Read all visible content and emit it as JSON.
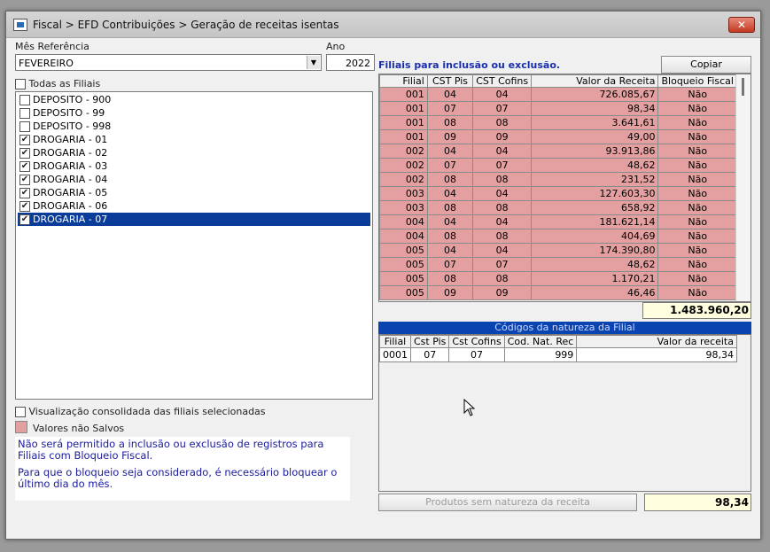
{
  "window": {
    "title": "Fiscal > EFD Contribuições > Geração de receitas isentas",
    "close_glyph": "✕"
  },
  "mes_referencia": {
    "label": "Mês Referência",
    "value": "FEVEREIRO"
  },
  "ano": {
    "label": "Ano",
    "value": "2022"
  },
  "todas_filiais": {
    "label": "Todas as Filiais",
    "checked": false
  },
  "filiais_list": [
    {
      "label": "DEPOSITO - 900",
      "checked": false,
      "selected": false
    },
    {
      "label": "DEPOSITO - 99",
      "checked": false,
      "selected": false
    },
    {
      "label": "DEPOSITO - 998",
      "checked": false,
      "selected": false
    },
    {
      "label": "DROGARIA - 01",
      "checked": true,
      "selected": false
    },
    {
      "label": "DROGARIA - 02",
      "checked": true,
      "selected": false
    },
    {
      "label": "DROGARIA - 03",
      "checked": true,
      "selected": false
    },
    {
      "label": "DROGARIA - 04",
      "checked": true,
      "selected": false
    },
    {
      "label": "DROGARIA - 05",
      "checked": true,
      "selected": false
    },
    {
      "label": "DROGARIA - 06",
      "checked": true,
      "selected": false
    },
    {
      "label": "DROGARIA - 07",
      "checked": true,
      "selected": true
    }
  ],
  "filiais_grid": {
    "title": "Filiais para inclusão ou exclusão.",
    "copy_button": "Copiar",
    "columns": [
      "Filial",
      "CST Pis",
      "CST Cofins",
      "Valor da Receita",
      "Bloqueio Fiscal"
    ],
    "rows": [
      [
        "001",
        "04",
        "04",
        "726.085,67",
        "Não"
      ],
      [
        "001",
        "07",
        "07",
        "98,34",
        "Não"
      ],
      [
        "001",
        "08",
        "08",
        "3.641,61",
        "Não"
      ],
      [
        "001",
        "09",
        "09",
        "49,00",
        "Não"
      ],
      [
        "002",
        "04",
        "04",
        "93.913,86",
        "Não"
      ],
      [
        "002",
        "07",
        "07",
        "48,62",
        "Não"
      ],
      [
        "002",
        "08",
        "08",
        "231,52",
        "Não"
      ],
      [
        "003",
        "04",
        "04",
        "127.603,30",
        "Não"
      ],
      [
        "003",
        "08",
        "08",
        "658,92",
        "Não"
      ],
      [
        "004",
        "04",
        "04",
        "181.621,14",
        "Não"
      ],
      [
        "004",
        "08",
        "08",
        "404,69",
        "Não"
      ],
      [
        "005",
        "04",
        "04",
        "174.390,80",
        "Não"
      ],
      [
        "005",
        "07",
        "07",
        "48,62",
        "Não"
      ],
      [
        "005",
        "08",
        "08",
        "1.170,21",
        "Não"
      ],
      [
        "005",
        "09",
        "09",
        "46,46",
        "Não"
      ]
    ],
    "total": "1.483.960,20"
  },
  "natureza_grid": {
    "title": "Códigos da natureza  da Filial",
    "columns": [
      "Filial",
      "Cst Pis",
      "Cst Cofins",
      "Cod. Nat. Rec",
      "Valor da receita"
    ],
    "rows": [
      [
        "0001",
        "07",
        "07",
        "999",
        "98,34"
      ]
    ],
    "button": "Produtos sem natureza  da receita",
    "total": "98,34"
  },
  "visualizacao": {
    "label": "Visualização consolidada das filiais selecionadas",
    "checked": false
  },
  "legend": {
    "label": "Valores não Salvos",
    "color": "#e4a0a0"
  },
  "info": {
    "line1": "Não será permitido a inclusão ou exclusão de registros para Filiais com Bloqueio Fiscal.",
    "line2": "Para que o bloqueio seja considerado, é necessário bloquear o último dia do mês."
  }
}
